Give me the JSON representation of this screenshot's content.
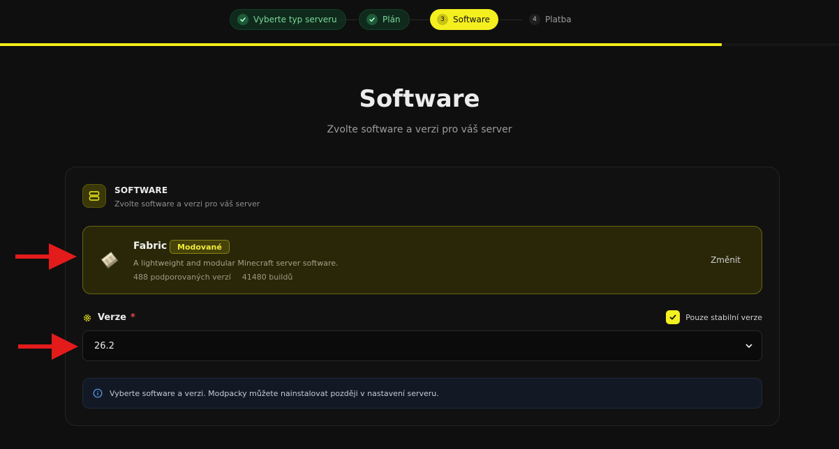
{
  "stepper": {
    "steps": [
      {
        "num": "✓",
        "label": "Vyberte typ serveru",
        "state": "done"
      },
      {
        "num": "✓",
        "label": "Plán",
        "state": "done"
      },
      {
        "num": "3",
        "label": "Software",
        "state": "active"
      },
      {
        "num": "4",
        "label": "Platba",
        "state": "todo"
      }
    ],
    "progress_fraction": 0.86
  },
  "header": {
    "title": "Software",
    "subtitle": "Zvolte software a verzi pro váš server"
  },
  "section": {
    "icon": "server-stack-icon",
    "title": "SOFTWARE",
    "subtitle": "Zvolte software a verzi pro váš server"
  },
  "software": {
    "icon": "fabric-logo",
    "name": "Fabric",
    "badge": "Modované",
    "description": "A lightweight and modular Minecraft server software.",
    "versions_count": "488 podporovaných verzí",
    "builds_count": "41480 buildů",
    "change_label": "Změnit"
  },
  "version": {
    "label": "Verze",
    "required_marker": "*",
    "selected": "26.2",
    "stable_only_label": "Pouze stabilní verze",
    "stable_only_checked": true
  },
  "info": {
    "icon": "info-icon",
    "text": "Vyberte software a verzi. Modpacky můžete nainstalovat později v nastavení serveru."
  },
  "colors": {
    "accent": "#f4ef1f",
    "background": "#0f0f0f",
    "success": "#7bd79a",
    "arrow": "#e31b1b"
  }
}
